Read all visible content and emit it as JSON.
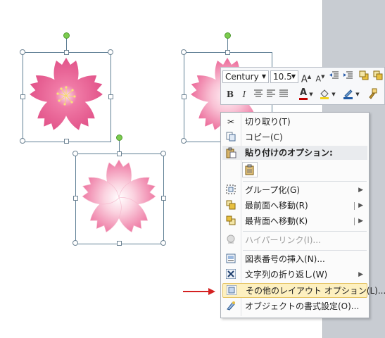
{
  "toolbar": {
    "font_name": "Century",
    "font_size": "10.5",
    "bold": "B",
    "italic": "I",
    "font_color_letter": "A"
  },
  "menu": {
    "cut": {
      "label": "切り取り(T)",
      "icon": "scissors-icon"
    },
    "copy": {
      "label": "コピー(C)",
      "icon": "copy-icon"
    },
    "paste_header": {
      "label": "貼り付けのオプション:",
      "icon": "paste-icon"
    },
    "paste_option": {
      "icon": "paste-keep-format-icon"
    },
    "group": {
      "label": "グループ化(G)",
      "icon": "group-icon"
    },
    "bring_front": {
      "label": "最前面へ移動(R)",
      "icon": "bring-to-front-icon"
    },
    "send_back": {
      "label": "最背面へ移動(K)",
      "icon": "send-to-back-icon"
    },
    "hyperlink": {
      "label": "ハイパーリンク(I)...",
      "icon": "hyperlink-icon",
      "disabled": true
    },
    "caption": {
      "label": "図表番号の挿入(N)...",
      "icon": "caption-icon"
    },
    "wrap": {
      "label": "文字列の折り返し(W)",
      "icon": "text-wrap-icon"
    },
    "layout": {
      "label": "その他のレイアウト オプション(L)...",
      "icon": "layout-options-icon",
      "highlighted": true
    },
    "format": {
      "label": "オブジェクトの書式設定(O)...",
      "icon": "format-object-icon"
    }
  },
  "colors": {
    "accent_arrow": "#d42121",
    "highlight": "#fdf0c0",
    "flower_dark": "#e2548a",
    "flower_light": "#f6a3c1"
  }
}
